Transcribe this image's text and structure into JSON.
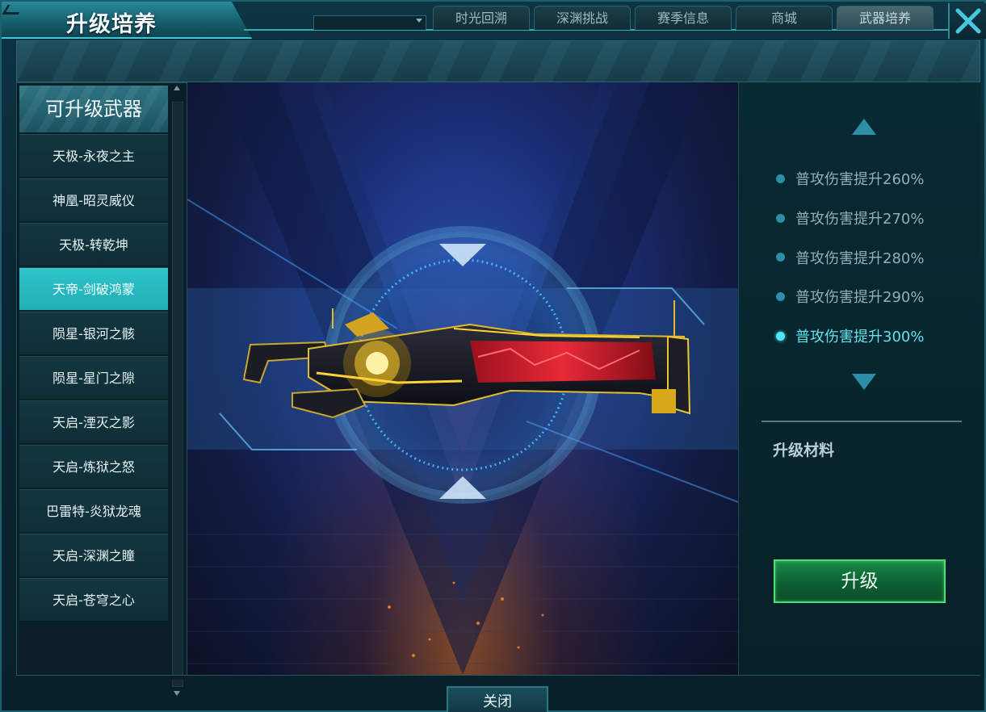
{
  "window": {
    "title": "升级培养",
    "close_icon": "close-x-icon"
  },
  "nav": {
    "tabs": [
      {
        "label": "时光回溯",
        "active": false
      },
      {
        "label": "深渊挑战",
        "active": false
      },
      {
        "label": "赛季信息",
        "active": false
      },
      {
        "label": "商城",
        "active": false
      },
      {
        "label": "武器培养",
        "active": true
      }
    ]
  },
  "left": {
    "header": "可升级武器",
    "weapons": [
      {
        "label": "天极-永夜之主",
        "selected": false
      },
      {
        "label": "神凰-昭灵威仪",
        "selected": false
      },
      {
        "label": "天极-转乾坤",
        "selected": false
      },
      {
        "label": "天帝-剑破鸿蒙",
        "selected": true
      },
      {
        "label": "陨星-银河之骸",
        "selected": false
      },
      {
        "label": "陨星-星门之隙",
        "selected": false
      },
      {
        "label": "天启-湮灭之影",
        "selected": false
      },
      {
        "label": "天启-炼狱之怒",
        "selected": false
      },
      {
        "label": "巴雷特-炎狱龙魂",
        "selected": false
      },
      {
        "label": "天启-深渊之瞳",
        "selected": false
      },
      {
        "label": "天启-苍穹之心",
        "selected": false
      }
    ]
  },
  "right": {
    "levels": [
      {
        "label": "普攻伤害提升260%",
        "current": false
      },
      {
        "label": "普攻伤害提升270%",
        "current": false
      },
      {
        "label": "普攻伤害提升280%",
        "current": false
      },
      {
        "label": "普攻伤害提升290%",
        "current": false
      },
      {
        "label": "普攻伤害提升300%",
        "current": true
      }
    ],
    "materials_label": "升级材料",
    "upgrade_button": "升级"
  },
  "footer": {
    "close_button": "关闭"
  },
  "colors": {
    "accent_cyan": "#2ec4c9",
    "upgrade_green": "#1a8a4a",
    "level_current": "#5fe3ef"
  }
}
